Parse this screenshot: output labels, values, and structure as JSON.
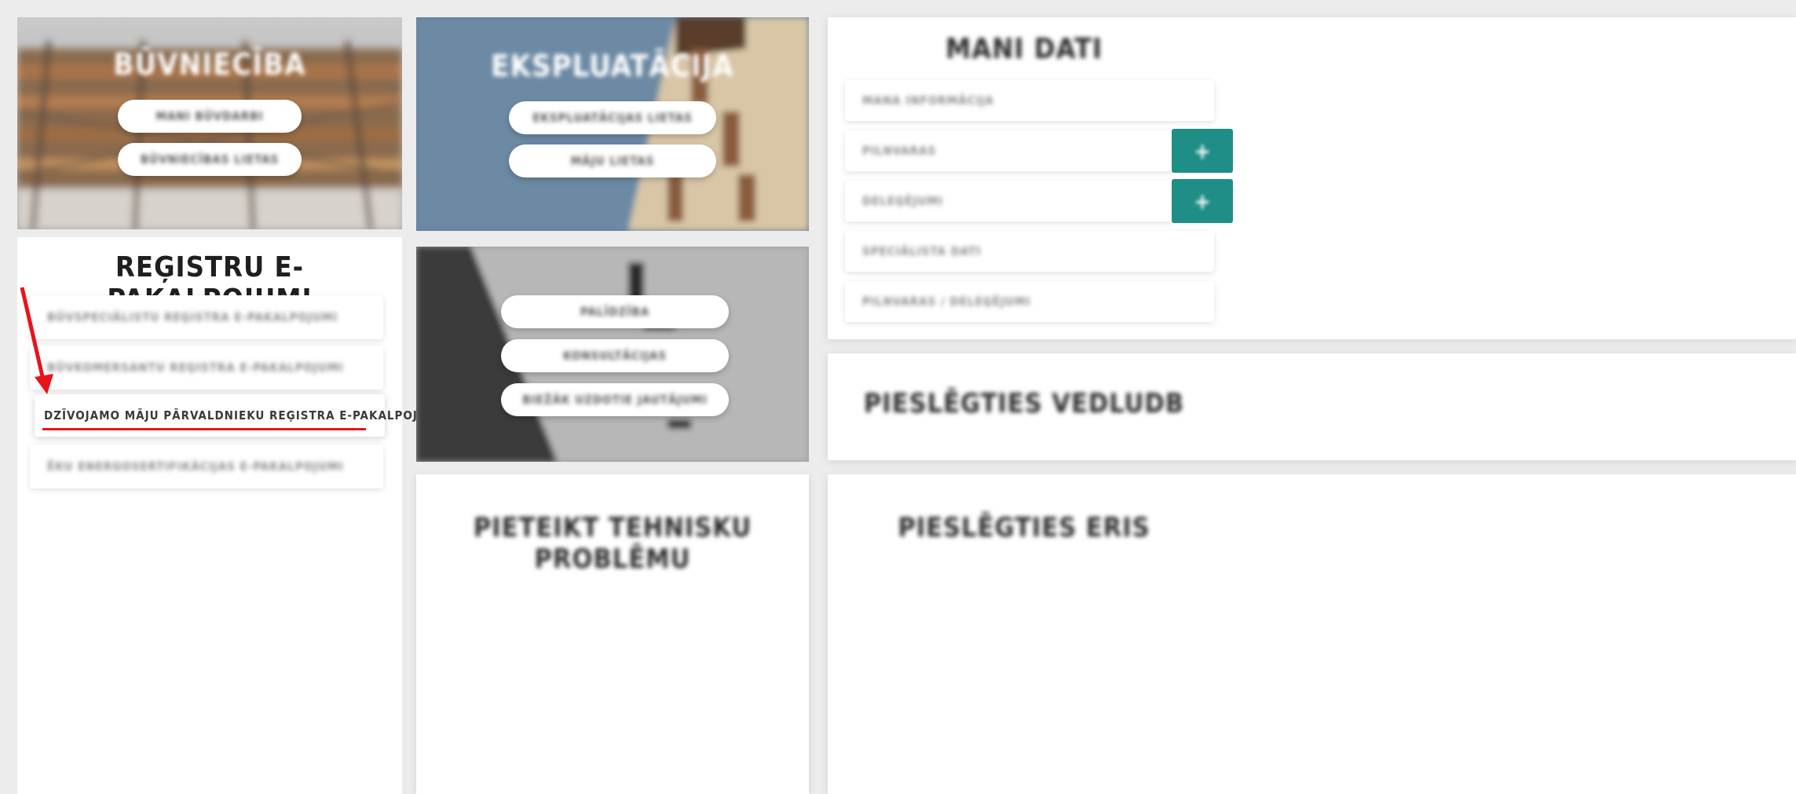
{
  "building_card": {
    "title": "BŪVNIECĪBA",
    "buttons": [
      "MANI BŪVDARBI",
      "BŪVNIECĪBAS LIETAS"
    ]
  },
  "exploitation_card": {
    "title": "EKSPLUATĀCIJA",
    "buttons": [
      "EKSPLUATĀCIJAS LIETAS",
      "MĀJU LIETAS"
    ]
  },
  "help_card": {
    "buttons": [
      "PALĪDZĪBA",
      "KONSULTĀCIJAS",
      "BIEŽĀK UZDOTIE JAUTĀJUMI"
    ]
  },
  "my_data": {
    "title": "MANI DATI",
    "items": [
      "MANA INFORMĀCIJA",
      "PILNVARAS",
      "DELEĢĒJUMI",
      "SPECIĀLISTA DATI",
      "PILNVARAS / DELEĢĒJUMI"
    ],
    "plus_label": "+"
  },
  "registers": {
    "title": "REĢISTRU E-PAKALPOJUMI",
    "items": [
      "BŪVSPECIĀLISTU REĢISTRA E-PAKALPOJUMI",
      "BŪVKOMERSANTU REĢISTRA E-PAKALPOJUMI",
      "DZĪVOJAMO MĀJU PĀRVALDNIEKU REĢISTRA E-PAKALPOJUMI",
      "ĒKU ENERGOSERTIFIKĀCIJAS E-PAKALPOJUMI"
    ]
  },
  "bottom_cards": {
    "report_problem": "PIETEIKT TEHNISKU PROBLĒMU",
    "login_supplier": "PIESLĒGTIES VEDLUDB",
    "login_eris": "PIESLĒGTIES ERIS"
  },
  "colors": {
    "accent_teal": "#1e8e86",
    "annotation_red": "#e8141b"
  },
  "icons": {
    "arrow": "arrow-down-icon",
    "plus": "plus-icon"
  }
}
